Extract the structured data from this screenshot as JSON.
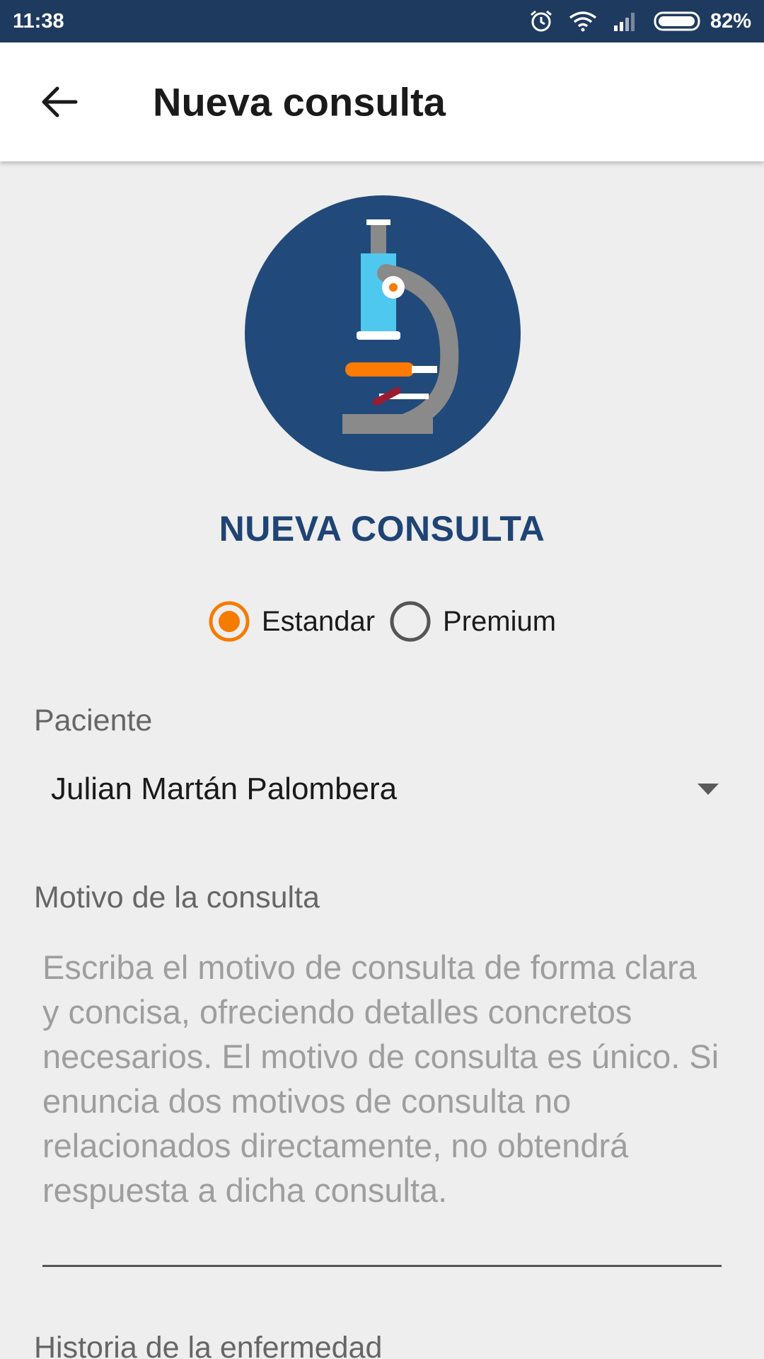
{
  "status_bar": {
    "time": "11:38",
    "battery": "82%",
    "icons": [
      "alarm-icon",
      "wifi-icon",
      "signal-icon",
      "battery-icon"
    ]
  },
  "app_bar": {
    "title": "Nueva consulta",
    "back_icon": "arrow-back-icon"
  },
  "header": {
    "logo_icon": "microscope-icon",
    "heading": "NUEVA CONSULTA"
  },
  "consult_type": {
    "options": [
      {
        "label": "Estandar",
        "selected": true
      },
      {
        "label": "Premium",
        "selected": false
      }
    ]
  },
  "patient": {
    "label": "Paciente",
    "value": "Julian Martán Palombera"
  },
  "reason": {
    "label": "Motivo de la consulta",
    "placeholder": "Escriba el motivo de consulta de forma clara y concisa, ofreciendo detalles concretos necesarios. El motivo de consulta es único. Si enuncia dos motivos de consulta no relacionados directamente, no obtendrá respuesta a dicha consulta."
  },
  "history": {
    "label": "Historia de la enfermedad"
  },
  "colors": {
    "status_bar": "#1f3a5f",
    "heading": "#1f4474",
    "logo_bg": "#214a7a",
    "radio_selected": "#f57c00",
    "radio_unselected": "#555555",
    "background": "#eeeeee"
  }
}
